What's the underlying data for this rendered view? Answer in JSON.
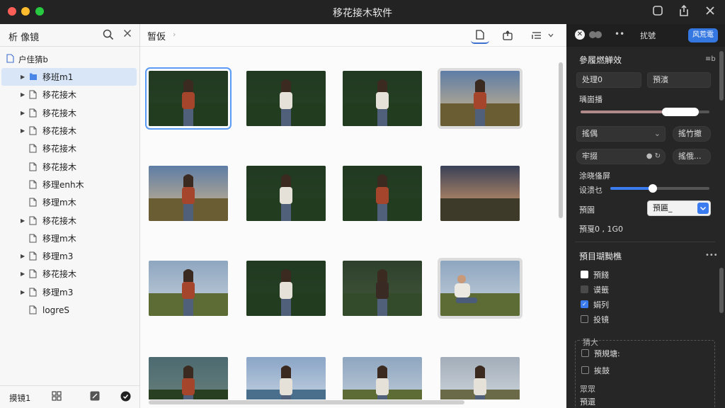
{
  "window": {
    "title": "移花接木软件",
    "icons": [
      "square-icon",
      "share-icon",
      "close-icon"
    ]
  },
  "sidebar": {
    "title": "析  像镜",
    "root_label": "户佳猜b",
    "items": [
      {
        "label": "移班m1",
        "has_arrow": true,
        "icon": "folder-icon",
        "selected": true
      },
      {
        "label": "移花接木",
        "has_arrow": true,
        "icon": "document-icon",
        "selected": false
      },
      {
        "label": "移花接木",
        "has_arrow": true,
        "icon": "document-icon",
        "selected": false
      },
      {
        "label": "移花接木",
        "has_arrow": true,
        "icon": "document-icon",
        "selected": false
      },
      {
        "label": "移花接木",
        "has_arrow": false,
        "icon": "document-icon",
        "selected": false
      },
      {
        "label": "移花接木",
        "has_arrow": false,
        "icon": "document-icon",
        "selected": false
      },
      {
        "label": "移理enh木",
        "has_arrow": false,
        "icon": "document-icon",
        "selected": false
      },
      {
        "label": "移理m木",
        "has_arrow": false,
        "icon": "document-icon",
        "selected": false
      },
      {
        "label": "移花接木",
        "has_arrow": true,
        "icon": "document-icon",
        "selected": false
      },
      {
        "label": "移理m木",
        "has_arrow": false,
        "icon": "document-icon",
        "selected": false
      },
      {
        "label": "移理m3",
        "has_arrow": true,
        "icon": "document-icon",
        "selected": false
      },
      {
        "label": "移花接木",
        "has_arrow": true,
        "icon": "document-icon",
        "selected": false
      },
      {
        "label": "移理m3",
        "has_arrow": true,
        "icon": "document-icon",
        "selected": false
      },
      {
        "label": "logreS",
        "has_arrow": false,
        "icon": "document-icon",
        "selected": false
      }
    ],
    "footer_label": "摸镜1"
  },
  "main": {
    "title": "暂仮",
    "thumbnails": [
      {
        "scene": "forest",
        "person": "woman-red",
        "selected": "blue"
      },
      {
        "scene": "forest",
        "person": "woman-white",
        "selected": ""
      },
      {
        "scene": "forest",
        "person": "woman-white",
        "selected": ""
      },
      {
        "scene": "field-sunset",
        "person": "woman-red",
        "selected": "gray"
      },
      {
        "scene": "field-sunset",
        "person": "woman-red",
        "selected": ""
      },
      {
        "scene": "forest",
        "person": "woman-white",
        "selected": ""
      },
      {
        "scene": "forest",
        "person": "woman-red",
        "selected": ""
      },
      {
        "scene": "field-dusk",
        "person": "",
        "selected": ""
      },
      {
        "scene": "hills",
        "person": "man-red",
        "selected": ""
      },
      {
        "scene": "forest",
        "person": "woman-white",
        "selected": ""
      },
      {
        "scene": "forest-path",
        "person": "woman-dark",
        "selected": ""
      },
      {
        "scene": "hills",
        "person": "man-sitting",
        "selected": "gray"
      },
      {
        "scene": "forest-sky",
        "person": "woman-red",
        "selected": ""
      },
      {
        "scene": "lake",
        "person": "woman-white",
        "selected": ""
      },
      {
        "scene": "hills",
        "person": "woman-white",
        "selected": ""
      },
      {
        "scene": "hills-cloudy",
        "person": "woman-white",
        "selected": ""
      }
    ]
  },
  "panel": {
    "tab_label": "扰號",
    "primary_button": "风荒電",
    "section1_title": "參履燃觯效",
    "section1_ellipsis": "≡b",
    "field_left": "处理0",
    "field_right": "預濱",
    "slider1_label": "瑀崮播",
    "slider1_value": 0.74,
    "dropdown_label": "搖偶",
    "dropdown_side": "搖竹撤",
    "field3_label": "牢掇",
    "field3_side": "搖俄...",
    "section2_label": "涂晓俻屏",
    "slider2_label": "设溃乜",
    "slider2_value": 0.43,
    "select_label": "預園",
    "select_value": "預匾_",
    "info_text": "預戛0 , 1G0",
    "section3_title": "預目瑚黝樵",
    "section3_ellipsis": "•••",
    "checkboxes": [
      {
        "label": "預餞",
        "state": "on"
      },
      {
        "label": "谟籤",
        "state": "mid"
      },
      {
        "label": "娟列",
        "state": "blue"
      },
      {
        "label": "投镜",
        "state": "off"
      }
    ],
    "box_header": "猜大",
    "box_items": [
      {
        "label": "預規塘:",
        "state": "off"
      },
      {
        "label": "挨鼓",
        "state": "off"
      }
    ],
    "footer_label1": "眾眾",
    "footer_label2": "預還"
  },
  "colors": {
    "accent": "#3477e0",
    "selected_row": "#d8e6f8",
    "panel_bg": "#262626",
    "titlebar_bg": "#232323"
  }
}
